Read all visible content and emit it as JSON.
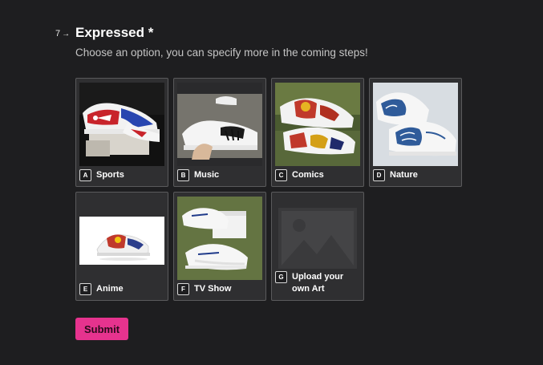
{
  "question": {
    "number": "7",
    "title": "Expressed *",
    "subtitle": "Choose an option, you can specify more in the coming steps!"
  },
  "options": [
    {
      "key": "A",
      "label": "Sports"
    },
    {
      "key": "B",
      "label": "Music"
    },
    {
      "key": "C",
      "label": "Comics"
    },
    {
      "key": "D",
      "label": "Nature"
    },
    {
      "key": "E",
      "label": "Anime"
    },
    {
      "key": "F",
      "label": "TV Show"
    },
    {
      "key": "G",
      "label": "Upload your own Art"
    }
  ],
  "submit": {
    "label": "Submit"
  },
  "colors": {
    "background": "#1e1e20",
    "card": "#2f2f31",
    "accent": "#e6338e"
  }
}
